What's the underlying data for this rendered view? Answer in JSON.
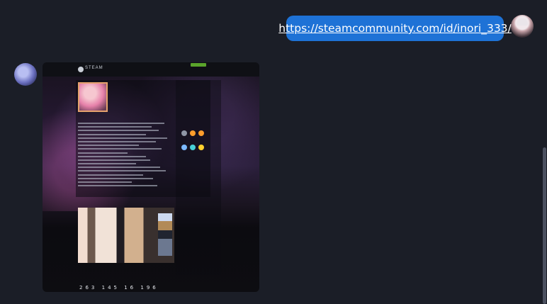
{
  "message": {
    "url": "https://steamcommunity.com/id/inori_333/"
  },
  "screenshot": {
    "brand": "STEAM",
    "stats": [
      "263",
      "145",
      "16",
      "196"
    ]
  }
}
